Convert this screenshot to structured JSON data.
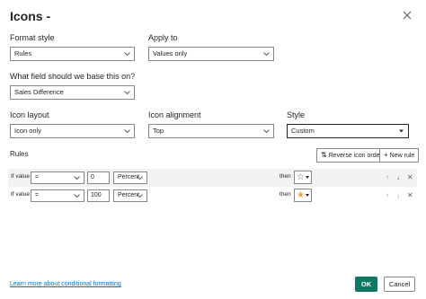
{
  "dialog": {
    "title": "Icons -",
    "close_icon": "close-icon"
  },
  "format_style": {
    "label": "Format style",
    "value": "Rules"
  },
  "apply_to": {
    "label": "Apply to",
    "value": "Values only"
  },
  "field": {
    "label": "What field should we base this on?",
    "value": "Sales Difference"
  },
  "icon_layout": {
    "label": "Icon layout",
    "value": "Icon only"
  },
  "icon_alignment": {
    "label": "Icon alignment",
    "value": "Top"
  },
  "style": {
    "label": "Style",
    "value": "Custom"
  },
  "rules": {
    "label": "Rules",
    "reverse_button": "Reverse icon order",
    "new_rule_button": "New rule",
    "rows": [
      {
        "if_value_label": "If value",
        "operator": "=",
        "number": "0",
        "unit": "Percent",
        "then_label": "then",
        "icon": "empty-star-icon",
        "icon_color": "#605e5c"
      },
      {
        "if_value_label": "If value",
        "operator": "=",
        "number": "100",
        "unit": "Percent",
        "then_label": "then",
        "icon": "filled-star-icon",
        "icon_color": "#e8a33d"
      }
    ]
  },
  "footer": {
    "link": "Learn more about conditional formatting",
    "ok": "OK",
    "cancel": "Cancel"
  },
  "colors": {
    "accent": "#117865",
    "link": "#0f6cbd",
    "star_gold": "#e8a33d"
  }
}
